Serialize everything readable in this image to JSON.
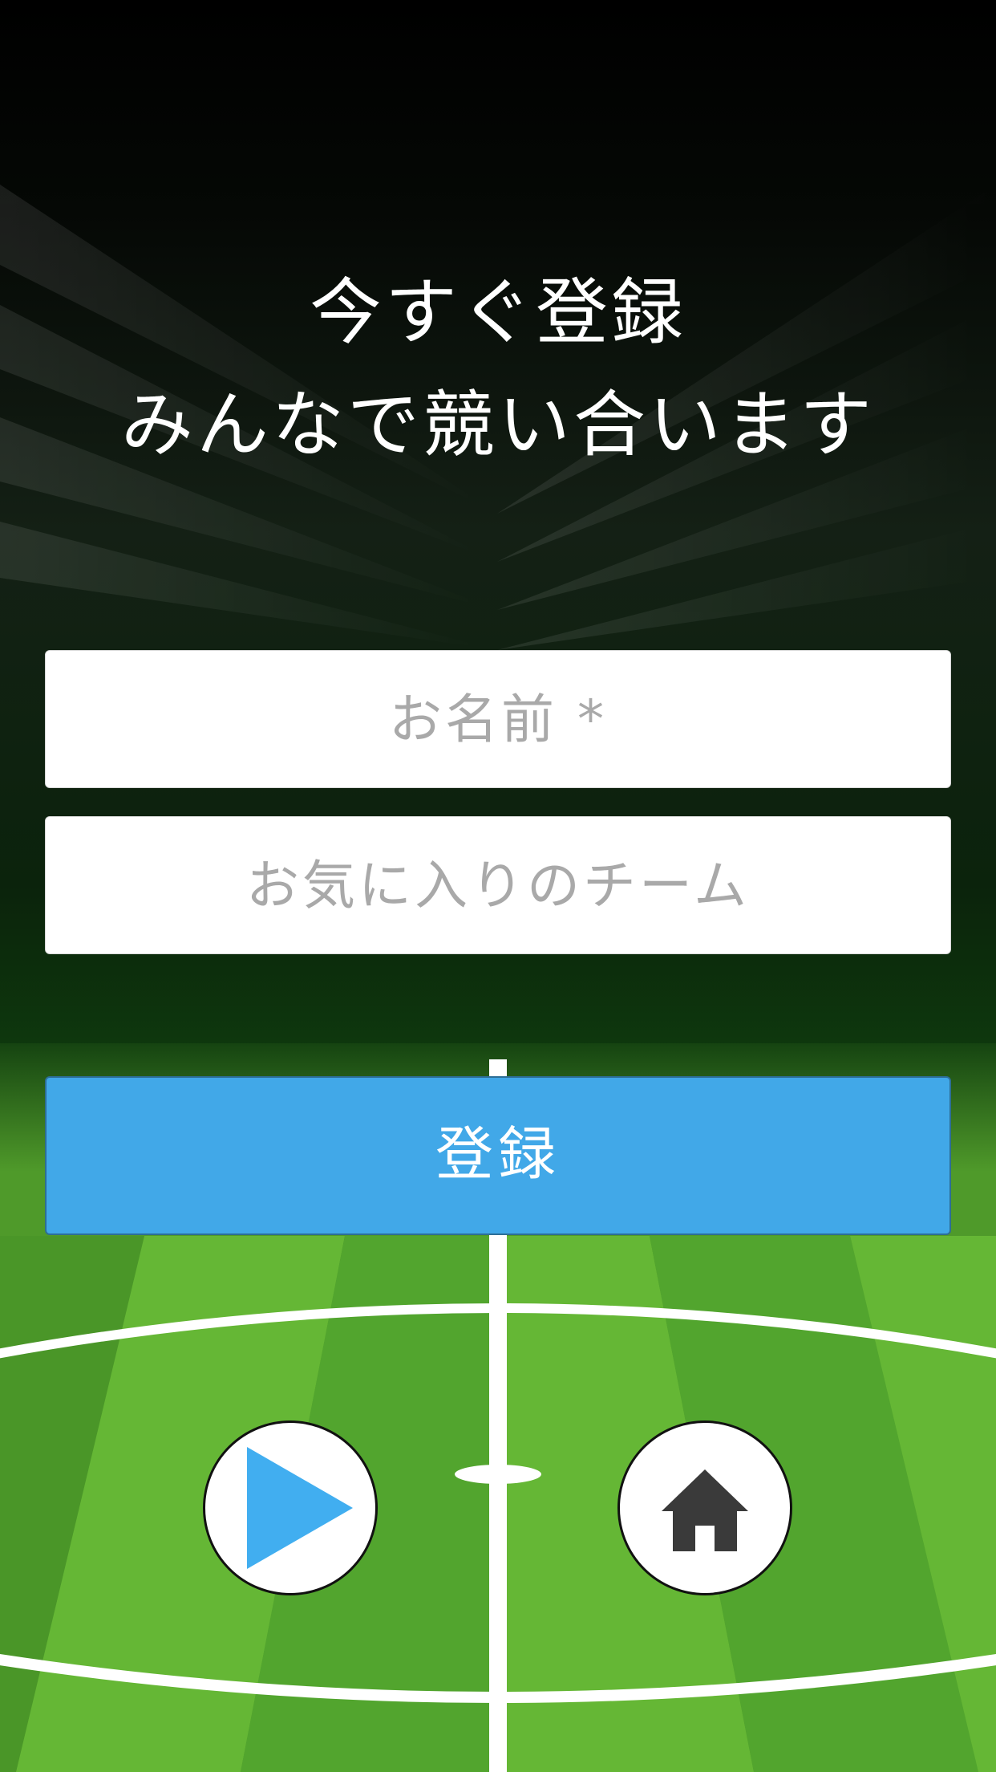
{
  "headline": {
    "line1": "今すぐ登録",
    "line2": "みんなで競い合います"
  },
  "form": {
    "name_placeholder": "お名前 *",
    "name_value": "",
    "team_placeholder": "お気に入りのチーム",
    "team_value": ""
  },
  "register_label": "登録",
  "buttons": {
    "play_icon": "play-icon",
    "home_icon": "home-icon"
  },
  "colors": {
    "accent": "#41a8e8",
    "field_green": "#5db33a",
    "background_top": "#000000"
  }
}
